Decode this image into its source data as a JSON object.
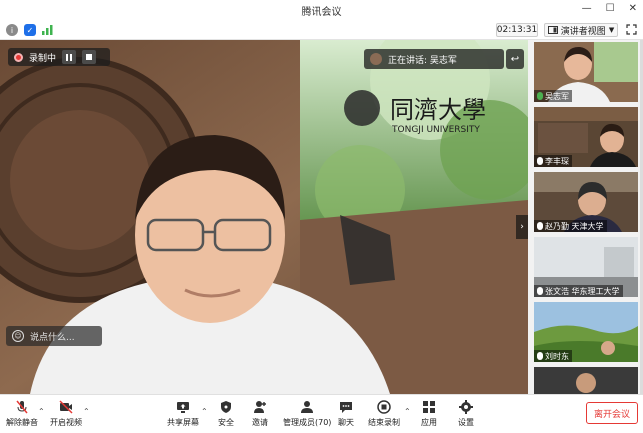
{
  "window": {
    "title": "腾讯会议",
    "controls": [
      "—",
      "☐",
      "✕"
    ]
  },
  "infobar": {
    "timer": "02:13:31",
    "view_label": "演讲者视图",
    "icons": [
      "info-icon",
      "shield-icon",
      "signal-icon",
      "fullscreen-icon"
    ]
  },
  "main": {
    "recording_label": "录制中",
    "speaking_label": "正在讲话: 吴志军",
    "logo_text": "同濟大學",
    "logo_subtext": "TONGJI UNIVERSITY",
    "chat_placeholder": "说点什么..."
  },
  "gallery": {
    "tiles": [
      {
        "name": "吴志军"
      },
      {
        "name": "李丰琛"
      },
      {
        "name": "赵乃勤 天津大学"
      },
      {
        "name": "张文浩 华东理工大学"
      },
      {
        "name": "刘时东"
      },
      {
        "name": ""
      }
    ]
  },
  "toolbar": {
    "mute": "解除静音",
    "video": "开启视频",
    "share": "共享屏幕",
    "security": "安全",
    "invite": "邀请",
    "members": "管理成员(70)",
    "chat": "聊天",
    "record": "结束录制",
    "apps": "应用",
    "settings": "设置",
    "leave": "离开会议"
  },
  "colors": {
    "record_red": "#e53935",
    "leave_red": "#e53935",
    "accent_blue": "#1e6fe8",
    "signal_green": "#3fb34f"
  }
}
